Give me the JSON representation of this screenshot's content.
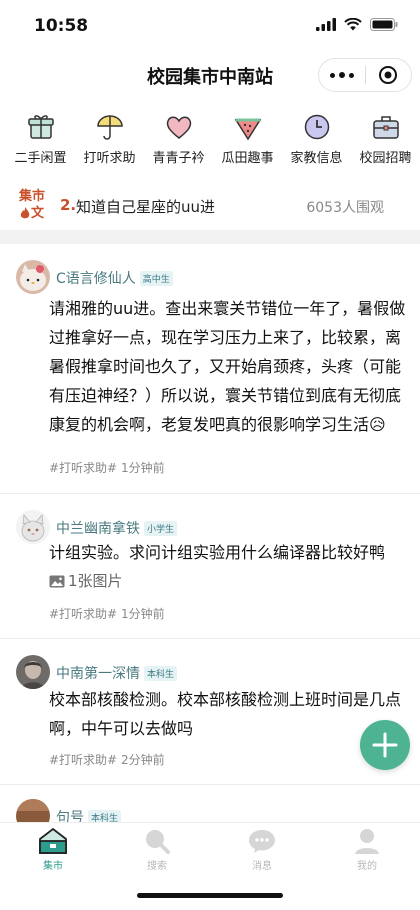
{
  "status": {
    "time": "10:58"
  },
  "nav": {
    "title": "校园集市中南站"
  },
  "categories": [
    {
      "label": "二手闲置",
      "icon": "gift-box-icon"
    },
    {
      "label": "打听求助",
      "icon": "umbrella-icon"
    },
    {
      "label": "青青子衿",
      "icon": "heart-icon"
    },
    {
      "label": "瓜田趣事",
      "icon": "watermelon-icon"
    },
    {
      "label": "家教信息",
      "icon": "clock-icon"
    },
    {
      "label": "校园招聘",
      "icon": "briefcase-icon"
    }
  ],
  "hot": {
    "badge_line1": "集市",
    "badge_line2": "文",
    "rank": "2.",
    "text": "知道自己星座的uu进",
    "count": "6053人围观"
  },
  "posts": [
    {
      "author": "C语言修仙人",
      "grade": "高中生",
      "content": "请湘雅的uu进。查出来寰关节错位一年了，暑假做过推拿好一点，现在学习压力上来了，比较累，离暑假推拿时间也久了，又开始肩颈疼，头疼（可能有压迫神经？）所以说，寰关节错位到底有无彻底康复的机会啊，老复发吧真的很影响学习生活😥",
      "tag": "#打听求助#",
      "time": "1分钟前"
    },
    {
      "author": "中兰幽南拿铁",
      "grade": "小学生",
      "content": "计组实验。求问计组实验用什么编译器比较好鸭",
      "image_note": "1张图片",
      "tag": "#打听求助#",
      "time": "1分钟前"
    },
    {
      "author": "中南第一深情",
      "grade": "本科生",
      "content": "校本部核酸检测。校本部核酸检测上班时间是几点啊，中午可以去做吗",
      "tag": "#打听求助#",
      "time": "2分钟前"
    },
    {
      "author": "句号",
      "grade": "本科生"
    }
  ],
  "tabbar": [
    {
      "label": "集市",
      "active": true
    },
    {
      "label": "搜索",
      "active": false
    },
    {
      "label": "消息",
      "active": false
    },
    {
      "label": "我的",
      "active": false
    }
  ],
  "colors": {
    "accent": "#4eb393",
    "hot": "#c8502a",
    "author": "#4a7a80"
  }
}
